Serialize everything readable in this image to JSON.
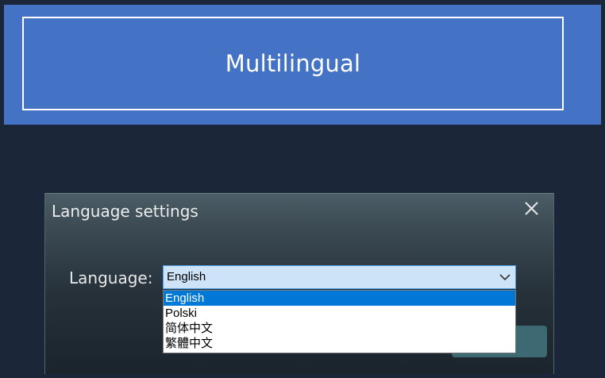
{
  "banner": {
    "title": "Multilingual"
  },
  "dialog": {
    "title": "Language settings",
    "language_label": "Language:",
    "selected_language": "English",
    "options": [
      "English",
      "Polski",
      "简体中文",
      "繁體中文"
    ],
    "highlighted_option": "English"
  },
  "colors": {
    "banner_bg": "#4472c4",
    "page_bg": "#1c2639",
    "select_bg": "#cde3f7",
    "highlight": "#0078d7"
  },
  "icons": {
    "close": "close-icon",
    "dropdown": "chevron-down-icon"
  }
}
